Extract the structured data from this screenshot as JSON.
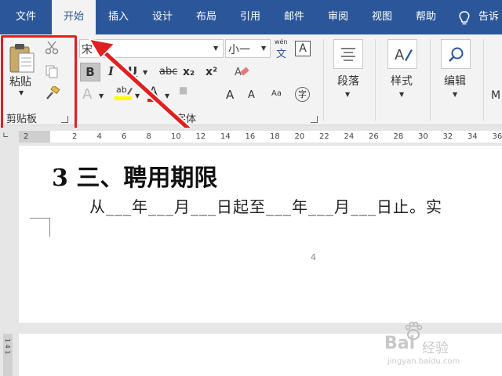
{
  "tabs": [
    {
      "label": "文件",
      "active": false
    },
    {
      "label": "开始",
      "active": true
    },
    {
      "label": "插入",
      "active": false
    },
    {
      "label": "设计",
      "active": false
    },
    {
      "label": "布局",
      "active": false
    },
    {
      "label": "引用",
      "active": false
    },
    {
      "label": "邮件",
      "active": false
    },
    {
      "label": "审阅",
      "active": false
    },
    {
      "label": "视图",
      "active": false
    },
    {
      "label": "帮助",
      "active": false
    }
  ],
  "tell_me": "告诉",
  "clipboard": {
    "paste_label": "粘贴",
    "group_label": "剪贴板"
  },
  "font": {
    "font_name": "宋",
    "font_size": "小一",
    "group_label": "字体",
    "wen_label": "wén",
    "wen_char": "文",
    "box_a": "A",
    "bold": "B",
    "italic": "I",
    "underline": "U",
    "strike": "abc",
    "subscript": "x₂",
    "superscript": "x²",
    "highlight_label": "ab",
    "font_color_label": "A",
    "grow": "A",
    "shrink": "A",
    "phonetic": "字"
  },
  "paragraph": {
    "label": "段落"
  },
  "styles": {
    "label": "样式"
  },
  "editing": {
    "label": "编辑"
  },
  "partial_group": "M",
  "ruler": {
    "left_tick": "2",
    "ticks": [
      "2",
      "4",
      "6",
      "8",
      "10",
      "12",
      "14",
      "16",
      "18",
      "20",
      "22",
      "24",
      "26",
      "28",
      "30",
      "32",
      "34",
      "36"
    ]
  },
  "vertical_ruler_text": "1 4 1",
  "document": {
    "heading": "3 三、聘用期限",
    "body": "从___年___月___日起至___年___月___日止。实",
    "page_number": "4"
  },
  "watermark": {
    "brand": "Bai",
    "brand_suffix": "经验",
    "url": "jingyan.baidu.com"
  },
  "colors": {
    "tab_bar": "#2b579a",
    "highlight": "#e02020",
    "highlighter_yellow": "#ffff00",
    "font_red": "#e02020"
  }
}
